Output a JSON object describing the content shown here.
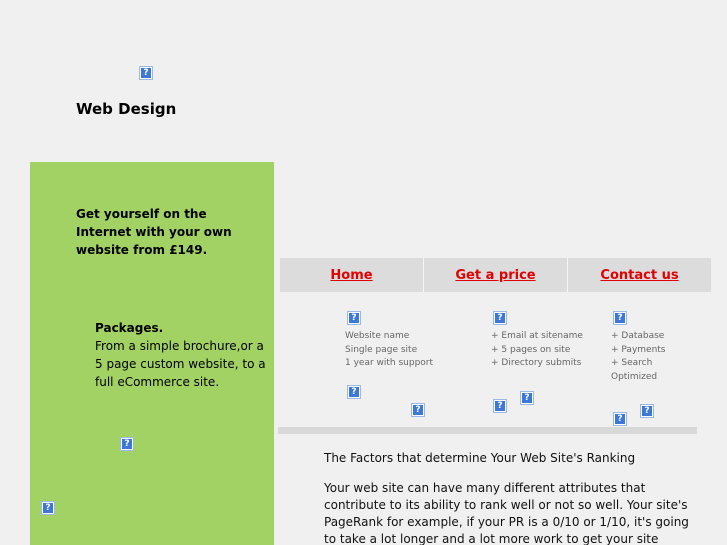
{
  "header": {
    "site_title": "Web Design"
  },
  "sidebar": {
    "tagline": "Get yourself on the Internet with your own website from £149.",
    "packages_title": "Packages.",
    "packages_text": "From a simple brochure,or a 5 page custom website, to a full eCommerce site."
  },
  "nav": {
    "tabs": [
      {
        "label": "Home"
      },
      {
        "label": "Get a price"
      },
      {
        "label": "Contact us"
      }
    ]
  },
  "features": [
    {
      "lines": [
        "Website name",
        "Single page site",
        "1 year with support"
      ]
    },
    {
      "lines": [
        "+ Email at sitename",
        "+ 5 pages on site",
        "+ Directory submits"
      ]
    },
    {
      "lines": [
        "+ Database",
        "+ Payments",
        "+ Search",
        "Optimized"
      ]
    }
  ],
  "article": {
    "heading": "The Factors that determine Your Web Site's Ranking",
    "body": "Your web site can have many different attributes that contribute to its ability to rank well or not so well. Your site's PageRank for example, if your PR is a 0/10 or 1/10, it's going to take a lot longer and a lot more work to get your site ranking well. If your"
  },
  "broken_image_glyph": "?",
  "colors": {
    "panel_green": "#a2d164",
    "nav_link_red": "#e40000",
    "nav_tab_bg": "#dcdcdc",
    "page_bg": "#f0f0f0"
  }
}
